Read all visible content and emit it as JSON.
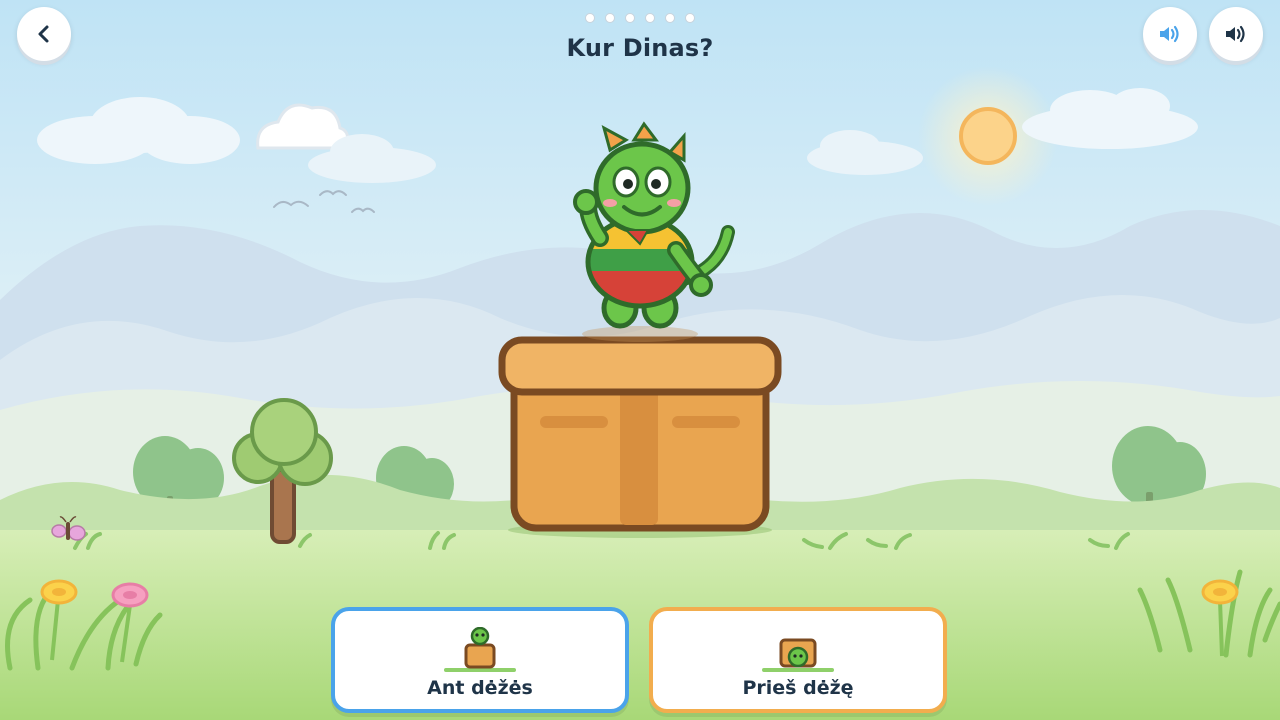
{
  "header": {
    "question": "Kur Dinas?",
    "progress_total": 6,
    "progress_current": 0
  },
  "controls": {
    "back_icon": "chevron-left-icon",
    "sound_icons": [
      "speaker-icon",
      "speaker-icon"
    ]
  },
  "answers": [
    {
      "label": "Ant dėžės",
      "icon": "dino-on-box-icon",
      "border_color": "#4aa3ea"
    },
    {
      "label": "Prieš dėžę",
      "icon": "dino-in-front-of-box-icon",
      "border_color": "#f2ad4e"
    }
  ],
  "colors": {
    "title": "#1f3448",
    "sky_top": "#bfe3f5",
    "grass": "#a8d877",
    "box": "#e9a550",
    "box_outline": "#7a4a22",
    "dino": "#6cc64a"
  }
}
